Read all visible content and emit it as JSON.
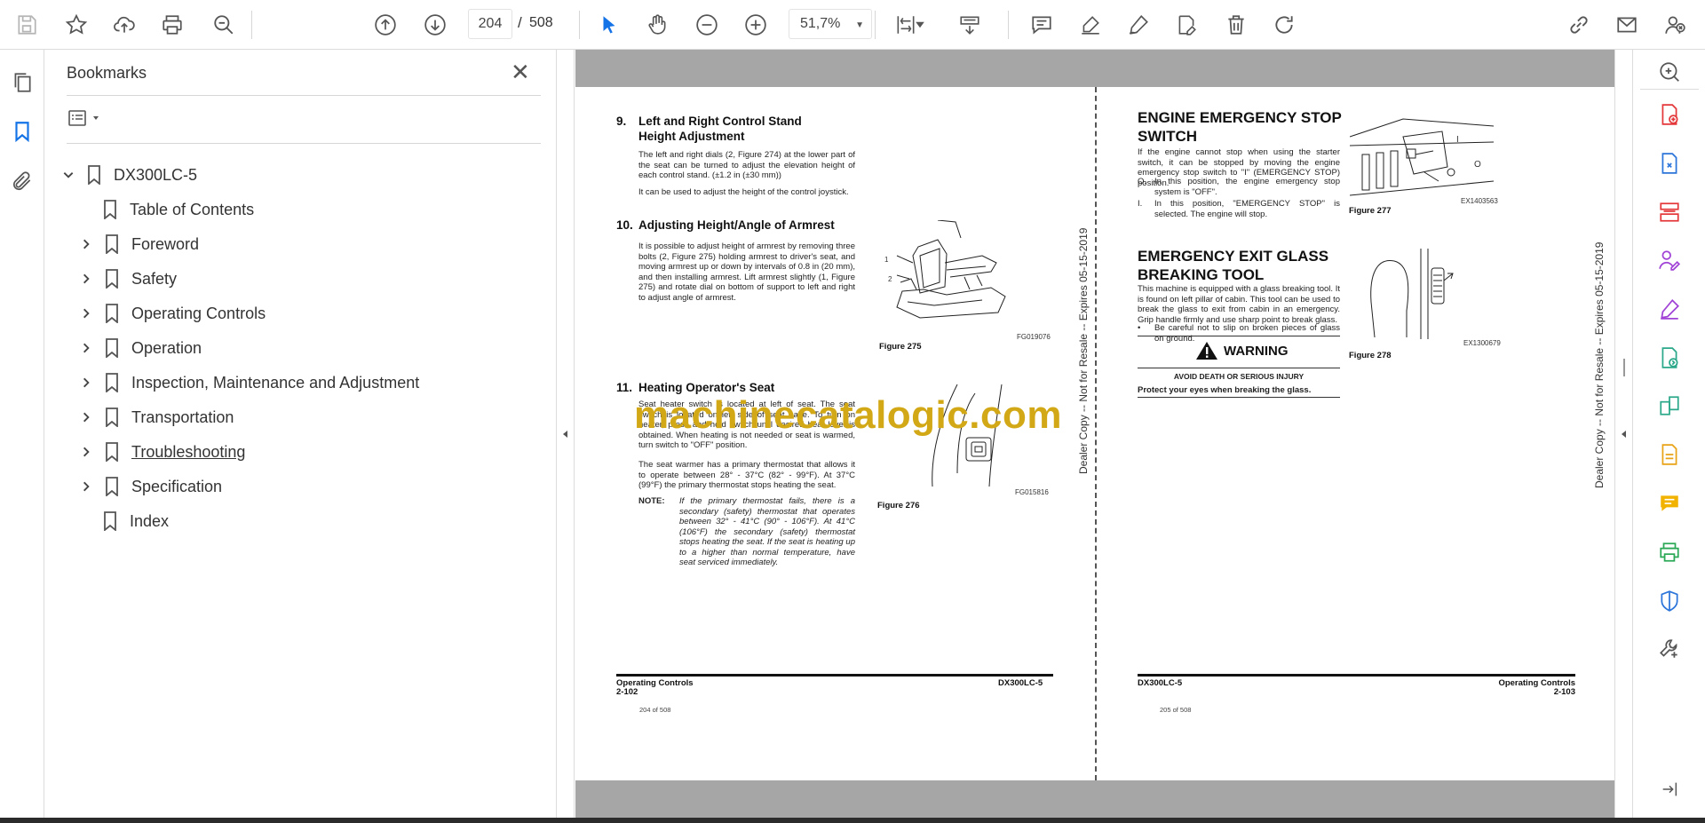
{
  "toolbar": {
    "page_current": "204",
    "page_sep": "/",
    "page_total": "508",
    "zoom": "51,7%"
  },
  "bookmarks": {
    "title": "Bookmarks",
    "close": "✕",
    "items": [
      {
        "label": "DX300LC-5",
        "expanded": true
      },
      {
        "label": "Table of Contents"
      },
      {
        "label": "Foreword"
      },
      {
        "label": "Safety"
      },
      {
        "label": "Operating Controls"
      },
      {
        "label": "Operation"
      },
      {
        "label": "Inspection, Maintenance and Adjustment"
      },
      {
        "label": "Transportation"
      },
      {
        "label": "Troubleshooting"
      },
      {
        "label": "Specification"
      },
      {
        "label": "Index"
      }
    ]
  },
  "watermark": "machinecatalogic.com",
  "left_page": {
    "sec9_num": "9.",
    "sec9_title": "Left and Right Control Stand Height Adjustment",
    "sec9_p1": "The left and right dials (2, Figure 274) at the lower part of the seat can be turned to adjust the elevation height of each control stand. (±1.2 in (±30 mm))",
    "sec9_p2": "It can be used to adjust the height of the control joystick.",
    "sec10_num": "10.",
    "sec10_title": "Adjusting Height/Angle of Armrest",
    "sec10_p1": "It is possible to adjust height of armrest by removing three bolts (2, Figure 275) holding armrest to driver's seat, and moving armrest up or down by intervals of 0.8 in (20 mm), and then installing armrest. Lift armrest slightly (1, Figure 275) and rotate dial on bottom of support to left and right to adjust angle of armrest.",
    "fig275_code": "FG019076",
    "fig275_cap": "Figure 275",
    "fig275_l1": "1",
    "fig275_l2": "2",
    "sec11_num": "11.",
    "sec11_title": "Heating Operator's Seat",
    "sec11_p1": "Seat heater switch is located at left of seat. The seat switch is located on left side of seat base. To turn on heater, press and hold switch until desired heat level is obtained. When heating is not needed or seat is warmed, turn switch to \"OFF\" position.",
    "sec11_p2": "The seat warmer has a primary thermostat that allows it to operate between 28° - 37°C (82° - 99°F). At 37°C (99°F) the primary thermostat stops heating the seat.",
    "note_label": "NOTE:",
    "note_text": "If the primary thermostat fails, there is a secondary (safety) thermostat that operates between 32° - 41°C (90° - 106°F). At 41°C (106°F) the secondary (safety) thermostat stops heating the seat. If the seat is heating up to a higher than normal temperature, have seat serviced immediately.",
    "fig276_code": "FG015816",
    "fig276_cap": "Figure 276",
    "vertical": "Dealer Copy -- Not for Resale -- Expires 05-15-2019",
    "footer_left1": "Operating Controls",
    "footer_left2": "2-102",
    "footer_right": "DX300LC-5",
    "page_of": "204 of 508"
  },
  "right_page": {
    "h1": "ENGINE EMERGENCY STOP SWITCH",
    "p1": "If the engine cannot stop when using the starter switch, it can be stopped by moving the engine emergency stop switch to \"I\" (EMERGENCY STOP) position.",
    "o_label": "O.",
    "o_text": "In this position, the engine emergency stop system is \"OFF\".",
    "i_label": "I.",
    "i_text": "In this position, \"EMERGENCY STOP\" is selected. The engine will stop.",
    "fig277_code": "EX1403563",
    "fig277_cap": "Figure 277",
    "fig277_l1": "I",
    "fig277_l2": "O",
    "h2": "EMERGENCY EXIT GLASS BREAKING TOOL",
    "p2": "This machine is equipped with a glass breaking tool. It is found on left pillar of cabin. This tool can be used to break the glass to exit from cabin in an emergency. Grip handle firmly and use sharp point to break glass.",
    "bullet": "Be careful not to slip on broken pieces of glass on ground.",
    "fig278_code": "EX1300679",
    "fig278_cap": "Figure 278",
    "warning": "WARNING",
    "warn_sub": "AVOID DEATH OR SERIOUS INJURY",
    "warn_text": "Protect your eyes when breaking the glass.",
    "vertical": "Dealer Copy -- Not for Resale -- Expires 05-15-2019",
    "footer_left": "DX300LC-5",
    "footer_right1": "Operating Controls",
    "footer_right2": "2-103",
    "page_of": "205 of 508"
  }
}
